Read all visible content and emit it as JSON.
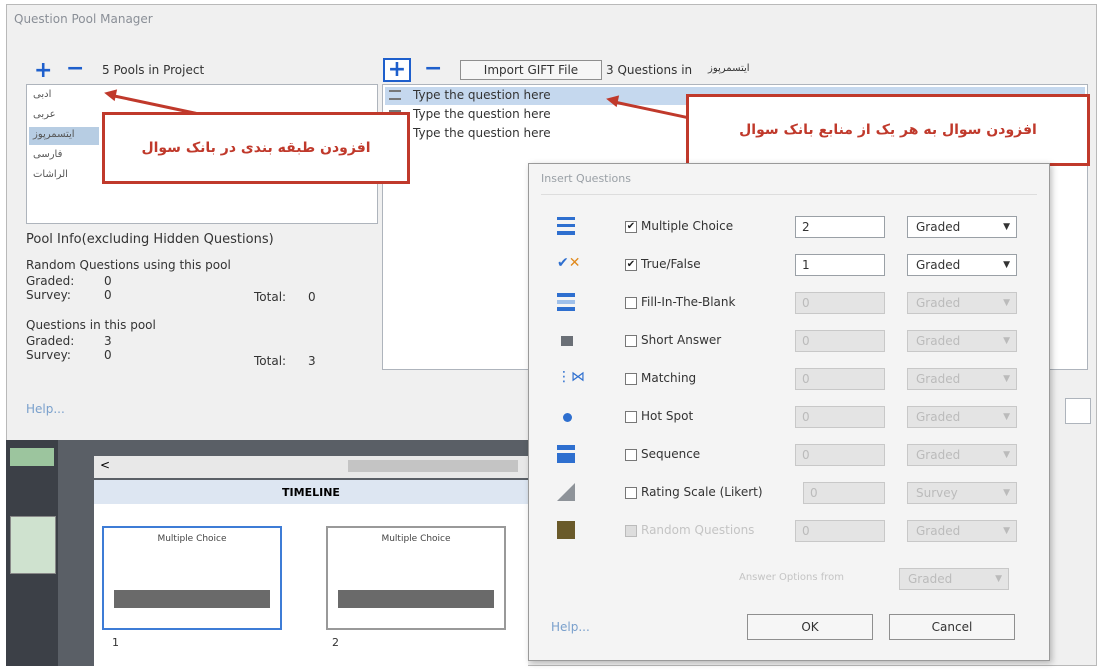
{
  "window": {
    "title": "Question Pool Manager"
  },
  "pools": {
    "count_label": "5 Pools in Project",
    "items": [
      "ادبی",
      "عربی",
      "ایتسمرپوز",
      "فارسی",
      "الراشات"
    ],
    "selected_index": 2
  },
  "questions": {
    "import_label": "Import GIFT File",
    "count_label": "3 Questions in",
    "pool_name": "ایتسمرپوز",
    "items": [
      "Type the question here",
      "Type the question here",
      "Type the question here"
    ]
  },
  "pool_info": {
    "heading": "Pool Info(excluding Hidden Questions)",
    "random_heading": "Random Questions using this pool",
    "random_graded_label": "Graded:",
    "random_graded_value": "0",
    "random_survey_label": "Survey:",
    "random_survey_value": "0",
    "random_total_label": "Total:",
    "random_total_value": "0",
    "inpool_heading": "Questions in this pool",
    "inpool_graded_label": "Graded:",
    "inpool_graded_value": "3",
    "inpool_survey_label": "Survey:",
    "inpool_survey_value": "0",
    "inpool_total_label": "Total:",
    "inpool_total_value": "3",
    "help": "Help..."
  },
  "annotations": {
    "pool_category": "افزودن طبقه بندی در بانک سوال",
    "add_question": "افزودن سوال به هر یک از منابع بانک سوال"
  },
  "timeline": {
    "header": "TIMELINE",
    "slides": [
      {
        "label": "1",
        "title": "Multiple Choice"
      },
      {
        "label": "2",
        "title": "Multiple Choice"
      }
    ]
  },
  "insert_dialog": {
    "title": "Insert Questions",
    "rows": [
      {
        "label": "Multiple Choice",
        "checked": true,
        "count": "2",
        "type": "Graded",
        "enabled": true,
        "icon": "multiple-choice-icon"
      },
      {
        "label": "True/False",
        "checked": true,
        "count": "1",
        "type": "Graded",
        "enabled": true,
        "icon": "true-false-icon"
      },
      {
        "label": "Fill-In-The-Blank",
        "checked": false,
        "count": "0",
        "type": "Graded",
        "enabled": false,
        "icon": "fill-blank-icon"
      },
      {
        "label": "Short Answer",
        "checked": false,
        "count": "0",
        "type": "Graded",
        "enabled": false,
        "icon": "short-answer-icon"
      },
      {
        "label": "Matching",
        "checked": false,
        "count": "0",
        "type": "Graded",
        "enabled": false,
        "icon": "matching-icon"
      },
      {
        "label": "Hot Spot",
        "checked": false,
        "count": "0",
        "type": "Graded",
        "enabled": false,
        "icon": "hot-spot-icon"
      },
      {
        "label": "Sequence",
        "checked": false,
        "count": "0",
        "type": "Graded",
        "enabled": false,
        "icon": "sequence-icon"
      },
      {
        "label": "Rating Scale (Likert)",
        "checked": false,
        "count": "0",
        "type": "Survey",
        "enabled": false,
        "icon": "likert-icon"
      },
      {
        "label": "Random Questions",
        "checked": false,
        "count": "0",
        "type": "Graded",
        "enabled": false,
        "icon": "random-questions-icon"
      }
    ],
    "answer_option_label": "Answer Options from",
    "answer_option_value": "Graded",
    "help": "Help...",
    "ok": "OK",
    "cancel": "Cancel"
  }
}
